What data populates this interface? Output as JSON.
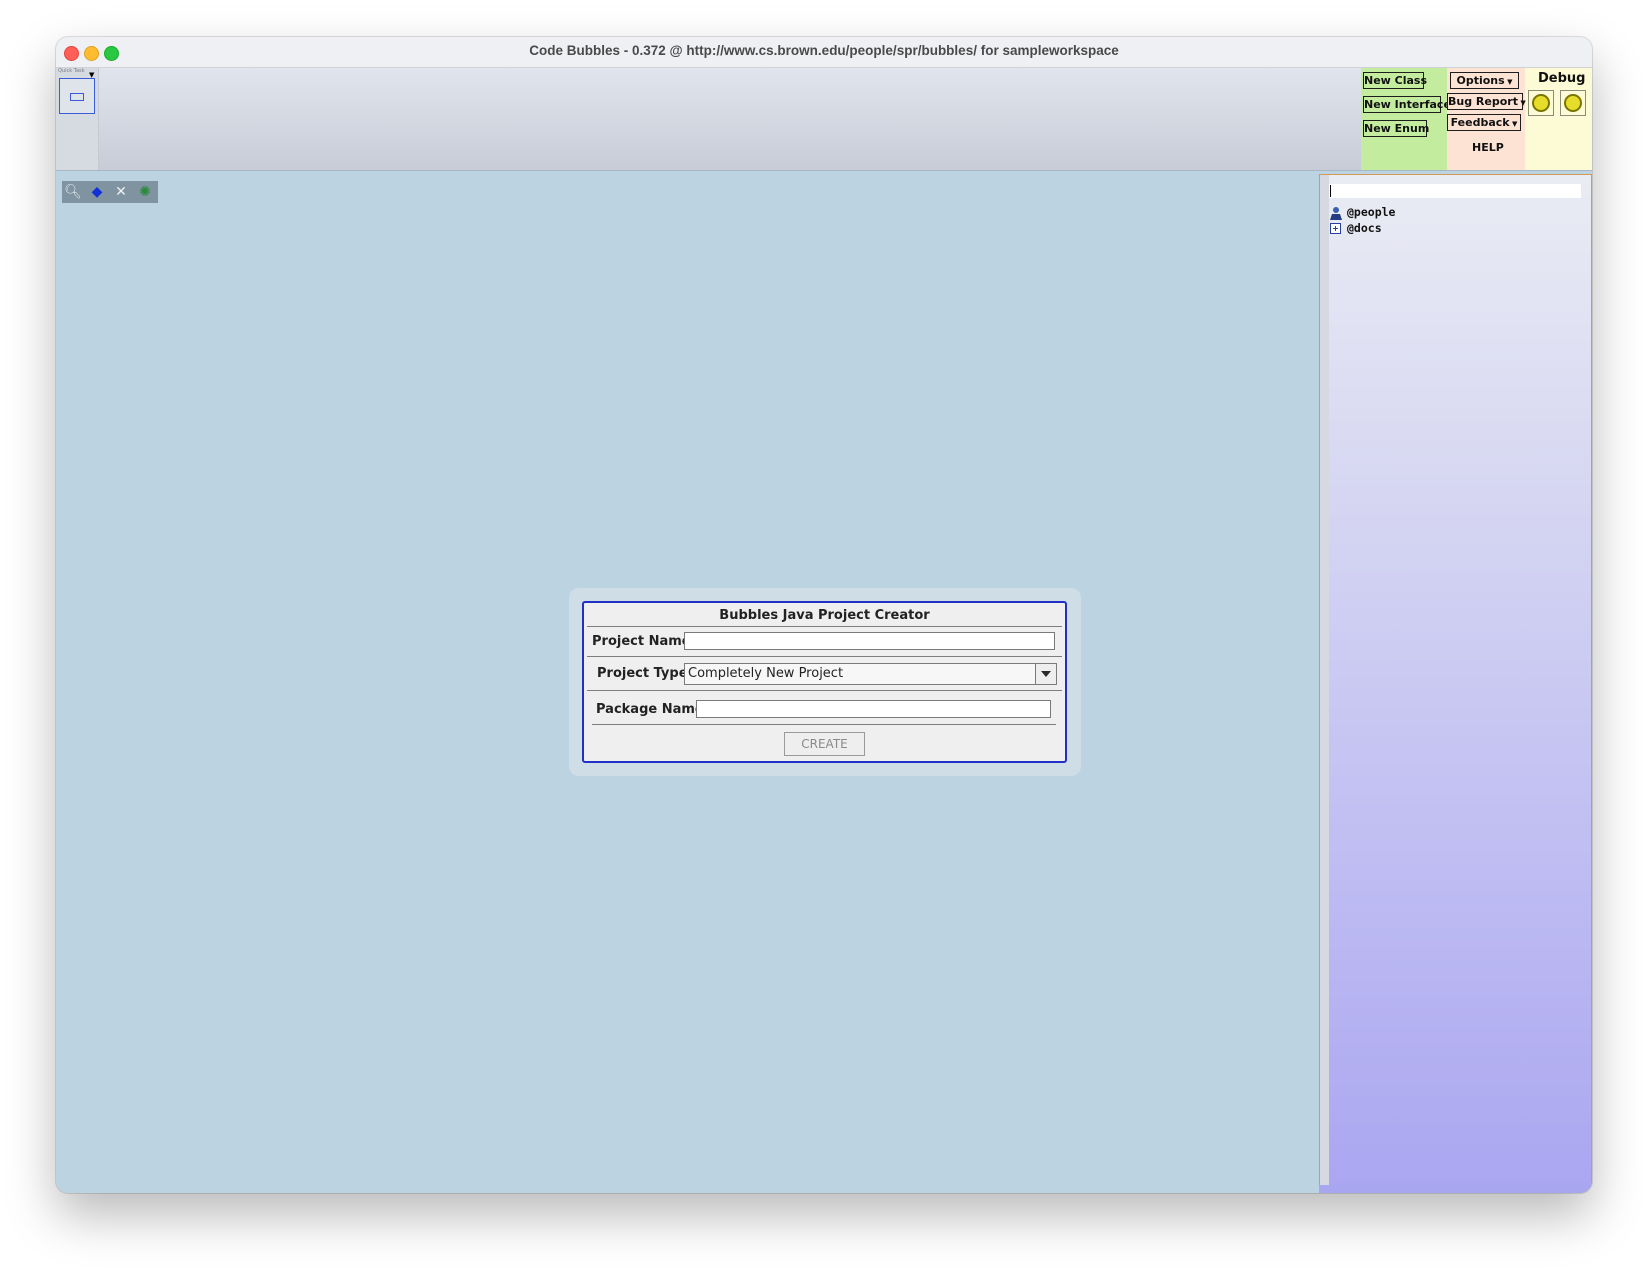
{
  "window": {
    "title": "Code Bubbles - 0.372 @ http://www.cs.brown.edu/people/spr/bubbles/ for sampleworkspace"
  },
  "overview": {
    "label": "Quick Task",
    "menu_icon": "triangle-down-icon"
  },
  "buttons": {
    "new_class": "New Class",
    "new_interface": "New Interface",
    "new_enum": "New Enum",
    "options": "Options",
    "bug_report": "Bug Report",
    "feedback": "Feedback",
    "help": "HELP",
    "debug": "Debug"
  },
  "colors": {
    "workspace_bg": "#bcd4e2",
    "green_panel": "#c4ec9f",
    "pink_panel": "#fde3d4",
    "yellow_panel": "#fdfbd5",
    "dialog_border": "#2230c8"
  },
  "toolbar_icons": [
    "search-icon",
    "bookmark-icon",
    "tools-icon",
    "settings-gear-icon"
  ],
  "dialog": {
    "title": "Bubbles Java Project Creator",
    "project_name_label": "Project Name :",
    "project_name_value": "",
    "project_type_label": "Project Type :",
    "project_type_value": "Completely New Project",
    "package_name_label": "Package Name :",
    "package_name_value": "",
    "create_label": "CREATE"
  },
  "side_panel": {
    "search_value": "",
    "items": [
      {
        "label": "@people",
        "icon": "person-icon"
      },
      {
        "label": "@docs",
        "icon": "expand-plus-icon"
      }
    ]
  }
}
